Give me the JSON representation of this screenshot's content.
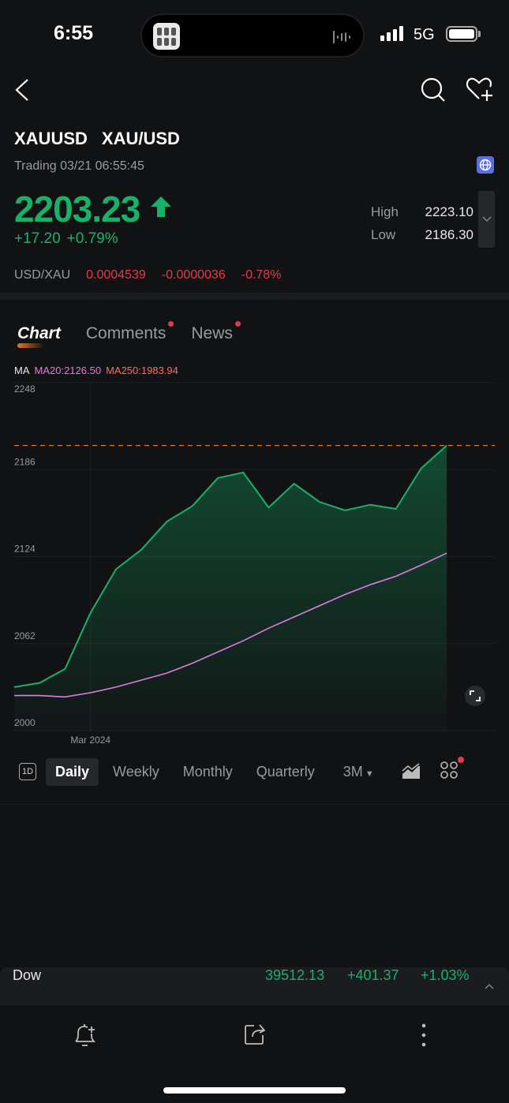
{
  "status_bar": {
    "time": "6:55",
    "network": "5G"
  },
  "header": {
    "symbol": "XAUUSD",
    "name": "XAU/USD",
    "trading_status": "Trading 03/21 06:55:45"
  },
  "quote": {
    "price": "2203.23",
    "direction": "up",
    "change": "+17.20",
    "change_pct": "+0.79%",
    "high_label": "High",
    "high": "2223.10",
    "low_label": "Low",
    "low": "2186.30"
  },
  "inverse": {
    "pair": "USD/XAU",
    "price": "0.0004539",
    "change": "-0.0000036",
    "change_pct": "-0.78%"
  },
  "tabs": [
    {
      "label": "Chart",
      "active": true
    },
    {
      "label": "Comments",
      "badge": true
    },
    {
      "label": "News",
      "badge": true
    }
  ],
  "indicators": {
    "label": "MA",
    "ma20": "MA20:2126.50",
    "ma250": "MA250:1983.94"
  },
  "colors": {
    "up": "#17b26a",
    "down": "#e5394d",
    "ma20": "#e07be0",
    "ma250": "#ff6b5b",
    "accent": "#e8761c",
    "background": "#111214"
  },
  "chart_data": {
    "type": "area",
    "ylim": [
      2000,
      2248
    ],
    "yticks": [
      "2248",
      "2186",
      "2124",
      "2062",
      "2000"
    ],
    "xtick_labels": [
      {
        "index": 3,
        "label": "Mar 2024"
      }
    ],
    "current_price_line": 2203.23,
    "grid": true,
    "series": [
      {
        "name": "XAUUSD",
        "values": [
          2031,
          2034,
          2044,
          2084,
          2115,
          2129,
          2149,
          2160,
          2180,
          2184,
          2159,
          2176,
          2163,
          2157,
          2161,
          2158,
          2187,
          2203.23
        ]
      },
      {
        "name": "MA20",
        "values": [
          2025,
          2025,
          2024,
          2027,
          2031,
          2036,
          2041,
          2048,
          2056,
          2064,
          2073,
          2081,
          2089,
          2097,
          2104,
          2110,
          2118,
          2126.5
        ]
      }
    ]
  },
  "periods": {
    "intraday": "1D",
    "items": [
      "Daily",
      "Weekly",
      "Monthly",
      "Quarterly"
    ],
    "active": "Daily",
    "range": "3M"
  },
  "ticker": {
    "name": "Dow",
    "value": "39512.13",
    "change": "+401.37",
    "change_pct": "+1.03%"
  }
}
